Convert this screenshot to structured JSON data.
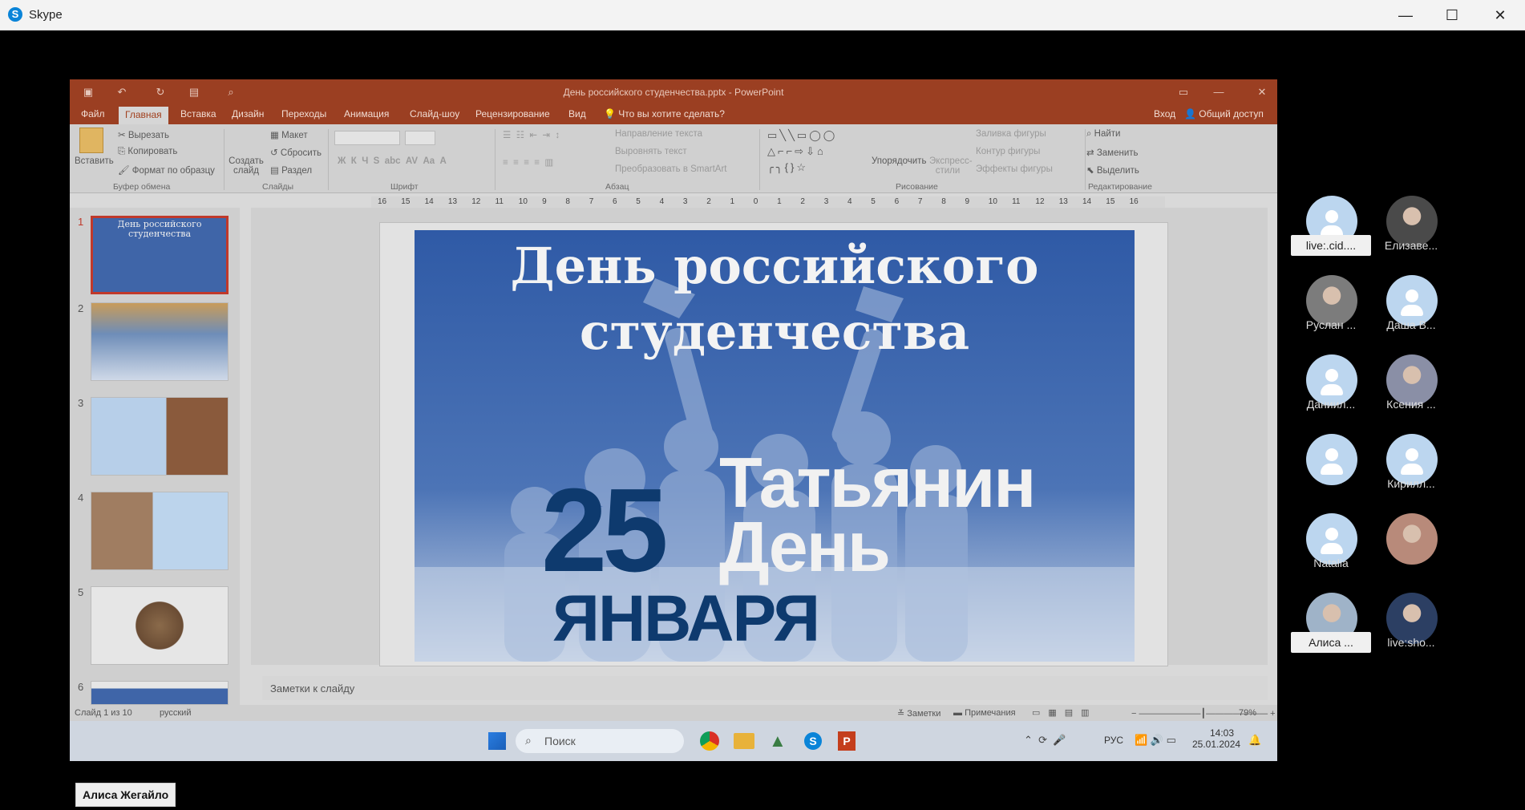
{
  "window": {
    "title": "Skype",
    "logo": "S",
    "minimize": "—",
    "maximize": "☐",
    "close": "✕"
  },
  "ppt": {
    "title": "День российского студенчества.pptx - PowerPoint",
    "tabs": [
      "Файл",
      "Главная",
      "Вставка",
      "Дизайн",
      "Переходы",
      "Анимация",
      "Слайд-шоу",
      "Рецензирование",
      "Вид"
    ],
    "tell_me": "Что вы хотите сделать?",
    "signin": "Вход",
    "share": "Общий доступ",
    "ribbon": {
      "paste": "Вставить",
      "cut": "Вырезать",
      "copy": "Копировать",
      "format_painter": "Формат по образцу",
      "clipboard": "Буфер обмена",
      "new_slide": "Создать слайд",
      "layout": "Макет",
      "reset": "Сбросить",
      "section": "Раздел",
      "slides": "Слайды",
      "font": "Шрифт",
      "text_direction": "Направление текста",
      "align_text": "Выровнять текст",
      "smartart": "Преобразовать в SmartArt",
      "paragraph": "Абзац",
      "arrange": "Упорядочить",
      "quick_styles": "Экспресс-стили",
      "shape_fill": "Заливка фигуры",
      "shape_outline": "Контур фигуры",
      "shape_effects": "Эффекты фигуры",
      "drawing": "Рисование",
      "find": "Найти",
      "replace": "Заменить",
      "select": "Выделить",
      "editing": "Редактирование"
    },
    "ruler_marks": [
      "16",
      "15",
      "14",
      "13",
      "12",
      "11",
      "10",
      "9",
      "8",
      "7",
      "6",
      "5",
      "4",
      "3",
      "2",
      "1",
      "0",
      "1",
      "2",
      "3",
      "4",
      "5",
      "6",
      "7",
      "8",
      "9",
      "10",
      "11",
      "12",
      "13",
      "14",
      "15",
      "16"
    ],
    "thumbnails": [
      "1",
      "2",
      "3",
      "4",
      "5",
      "6"
    ],
    "thumb1_title": "День российского студенчества",
    "slide": {
      "title_line1": "День российского",
      "title_line2": "студенчества",
      "date_number": "25",
      "month": "ЯНВАРЯ",
      "tatyanin": "Татьянин",
      "day": "День"
    },
    "notes_placeholder": "Заметки к слайду",
    "status": {
      "slide_count": "Слайд 1 из 10",
      "language": "русский",
      "notes": "Заметки",
      "comments": "Примечания",
      "zoom": "79%"
    },
    "taskbar": {
      "search": "Поиск",
      "lang": "РУС",
      "time": "14:03",
      "date": "25.01.2024"
    }
  },
  "participants": [
    {
      "name": "live:.cid....",
      "boxed": true,
      "photo": false
    },
    {
      "name": "Елизаве...",
      "boxed": false,
      "photo": true,
      "color": "#4a4a4a"
    },
    {
      "name": "Руслан ...",
      "boxed": false,
      "photo": true,
      "color": "#7c7c7c"
    },
    {
      "name": "Даша В...",
      "boxed": false,
      "photo": false
    },
    {
      "name": "Даниил...",
      "boxed": false,
      "photo": false
    },
    {
      "name": "Ксения ...",
      "boxed": false,
      "photo": true,
      "color": "#8a8fa6"
    },
    {
      "name": "",
      "boxed": false,
      "photo": false
    },
    {
      "name": "Кирилл...",
      "boxed": false,
      "photo": false
    },
    {
      "name": "Natalia",
      "boxed": false,
      "photo": false
    },
    {
      "name": "",
      "boxed": false,
      "photo": true,
      "color": "#b88a7a"
    },
    {
      "name": "Алиса ...",
      "boxed": true,
      "photo": true,
      "color": "#9fb3c8"
    },
    {
      "name": "live:sho...",
      "boxed": false,
      "photo": true,
      "color": "#2c3f63"
    }
  ],
  "active_speaker": "Алиса Жегайло"
}
